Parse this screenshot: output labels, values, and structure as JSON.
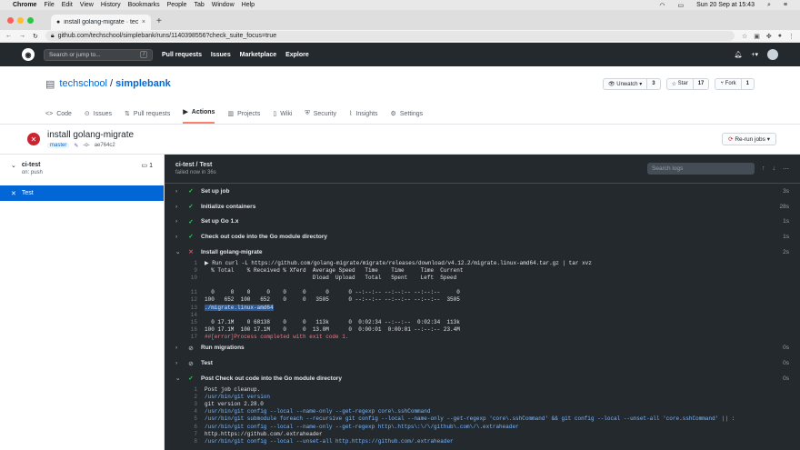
{
  "mac": {
    "app": "Chrome",
    "menus": [
      "File",
      "Edit",
      "View",
      "History",
      "Bookmarks",
      "People",
      "Tab",
      "Window",
      "Help"
    ],
    "clock": "Sun 20 Sep at 15:43"
  },
  "browser": {
    "tab_title": "install golang-migrate · techsc",
    "url": "github.com/techschool/simplebank/runs/1140398556?check_suite_focus=true"
  },
  "gh": {
    "search_placeholder": "Search or jump to...",
    "search_key": "/",
    "nav": [
      "Pull requests",
      "Issues",
      "Marketplace",
      "Explore"
    ]
  },
  "repo": {
    "owner": "techschool",
    "sep": " / ",
    "name": "simplebank",
    "unwatch": "Unwatch ▾",
    "watch_count": "3",
    "star": "Star",
    "star_count": "17",
    "fork": "Fork",
    "fork_count": "1",
    "tabs": [
      "Code",
      "Issues",
      "Pull requests",
      "Actions",
      "Projects",
      "Wiki",
      "Security",
      "Insights",
      "Settings"
    ],
    "active_tab": "Actions"
  },
  "run": {
    "title": "install golang-migrate",
    "branch": "master",
    "commit": "ae764c2",
    "rerun": "Re-run jobs ▾"
  },
  "sidebar": {
    "job_name": "ci-test",
    "job_status": "on: push",
    "job_count": "1",
    "selected": "Test"
  },
  "log": {
    "title": "ci-test / Test",
    "subtitle": "failed now in 36s",
    "search_placeholder": "Search logs",
    "steps_top": [
      {
        "name": "Set up job",
        "status": "ok",
        "dur": "3s"
      },
      {
        "name": "Initialize containers",
        "status": "ok",
        "dur": "28s"
      },
      {
        "name": "Set up Go 1.x",
        "status": "ok",
        "dur": "1s"
      },
      {
        "name": "Check out code into the Go module directory",
        "status": "ok",
        "dur": "1s"
      },
      {
        "name": "Install golang-migrate",
        "status": "bad",
        "dur": "2s"
      }
    ],
    "failed_lines": [
      {
        "n": "1",
        "t": "▶ Run curl -L https://github.com/golang-migrate/migrate/releases/download/v4.12.2/migrate.linux-amd64.tar.gz | tar xvz"
      },
      {
        "n": "9",
        "t": "  % Total    % Received % Xferd  Average Speed   Time    Time     Time  Current"
      },
      {
        "n": "10",
        "t": "                                 Dload  Upload   Total   Spent    Left  Speed"
      },
      {
        "n": "",
        "t": ""
      },
      {
        "n": "11",
        "t": "  0     0    0     0    0     0      0      0 --:--:-- --:--:-- --:--:--     0"
      },
      {
        "n": "12",
        "t": "100   652  100   652    0     0   3505      0 --:--:-- --:--:-- --:--:--  3505"
      },
      {
        "n": "13",
        "t": "./migrate.linux-amd64",
        "cls": "hl"
      },
      {
        "n": "14",
        "t": ""
      },
      {
        "n": "15",
        "t": "  0 17.1M    0 68138    0     0   113k      0  0:02:34 --:--:--  0:02:34  113k"
      },
      {
        "n": "16",
        "t": "100 17.1M  100 17.1M    0     0  13.0M      0  0:00:01  0:00:01 --:--:-- 23.4M"
      },
      {
        "n": "17",
        "t": "##[error]Process completed with exit code 1.",
        "cls": "red"
      }
    ],
    "steps_mid": [
      {
        "name": "Run migrations",
        "status": "skip",
        "dur": "0s"
      },
      {
        "name": "Test",
        "status": "skip",
        "dur": "0s"
      },
      {
        "name": "Post Check out code into the Go module directory",
        "status": "ok",
        "dur": "0s"
      }
    ],
    "post_lines": [
      {
        "n": "1",
        "t": "Post job cleanup."
      },
      {
        "n": "2",
        "t": "/usr/bin/git version",
        "cls": "blue"
      },
      {
        "n": "3",
        "t": "git version 2.28.0"
      },
      {
        "n": "4",
        "t": "/usr/bin/git config --local --name-only --get-regexp core\\.sshCommand",
        "cls": "blue"
      },
      {
        "n": "5",
        "t": "/usr/bin/git submodule foreach --recursive git config --local --name-only --get-regexp 'core\\.sshCommand' && git config --local --unset-all 'core.sshCommand' || :",
        "cls": "blue"
      },
      {
        "n": "6",
        "t": "/usr/bin/git config --local --name-only --get-regexp http\\.https\\:\\/\\/github\\.com\\/\\.extraheader",
        "cls": "blue"
      },
      {
        "n": "7",
        "t": "http.https://github.com/.extraheader"
      },
      {
        "n": "8",
        "t": "/usr/bin/git config --local --unset-all http.https://github.com/.extraheader",
        "cls": "blue"
      }
    ]
  }
}
